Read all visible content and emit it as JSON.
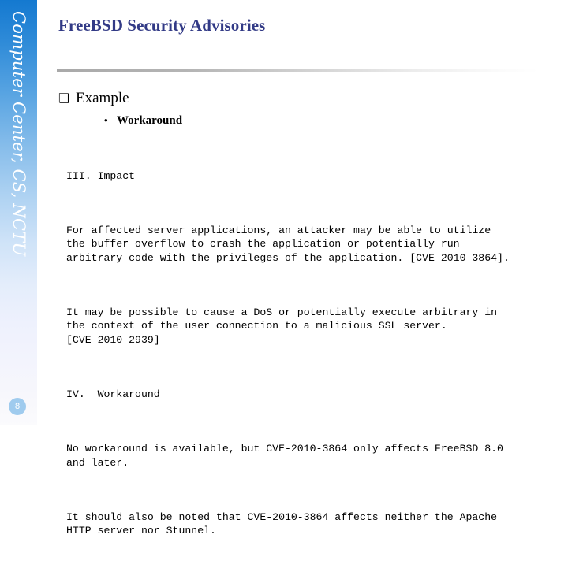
{
  "sidebar": {
    "brand": "Computer Center, CS, NCTU",
    "page_number": "8",
    "gradient_top_color": "#1479d0",
    "gradient_bottom_color": "#fbfbfd",
    "badge_color": "#9fcbee"
  },
  "slide": {
    "title": "FreeBSD Security Advisories",
    "title_color": "#323a86",
    "rule_color": "#a9a9a9"
  },
  "outline": {
    "level1": {
      "marker": "❑",
      "label": "Example"
    },
    "level2": {
      "marker": "•",
      "label": "Workaround"
    }
  },
  "advisory": {
    "section_impact_heading": "III. Impact",
    "impact_paragraph_1": "For affected server applications, an attacker may be able to utilize\nthe buffer overflow to crash the application or potentially run\narbitrary code with the privileges of the application. [CVE-2010-3864].",
    "impact_paragraph_2": "It may be possible to cause a DoS or potentially execute arbitrary in\nthe context of the user connection to a malicious SSL server.\n[CVE-2010-2939]",
    "section_workaround_heading": "IV.  Workaround",
    "workaround_paragraph_1": "No workaround is available, but CVE-2010-3864 only affects FreeBSD 8.0\nand later.",
    "workaround_paragraph_2": "It should also be noted that CVE-2010-3864 affects neither the Apache\nHTTP server nor Stunnel."
  }
}
